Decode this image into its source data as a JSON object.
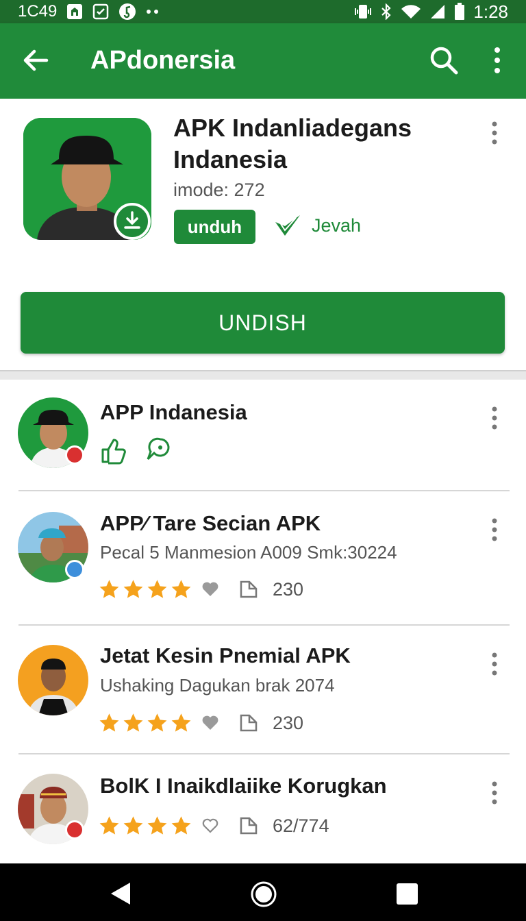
{
  "status_bar": {
    "left_text": "1C49",
    "time": "1:28"
  },
  "app_bar": {
    "title": "APdonersia",
    "back_icon": "arrow-left-icon",
    "search_icon": "search-icon",
    "more_icon": "more-vert-icon"
  },
  "hero": {
    "title": "APK Indanliadegans Indanesia",
    "subtitle": "imode: 272",
    "chip_label": "unduh",
    "verified_label": "Jevah",
    "primary_button": "UNDISH"
  },
  "list": [
    {
      "title": "APP Indanesia",
      "subtitle": "",
      "icons": [
        "thumbs-up-icon",
        "chat-icon"
      ]
    },
    {
      "title": "APP⁄ Tare Secian APK",
      "subtitle": "Pecal 5 Manmesion A009 Smk:30224",
      "rating": 4,
      "count": "230"
    },
    {
      "title": "Jetat Kesin Pnemial APK",
      "subtitle": "Ushaking Dagukan brak 2074",
      "rating": 4,
      "count": "230"
    },
    {
      "title": "BolK I Inaikdlaiike Korugkan",
      "subtitle": "",
      "rating": 4,
      "count": "62/774"
    }
  ],
  "colors": {
    "status_bar": "#1e6b2c",
    "app_bar": "#208b3a",
    "accent": "#1f8a39",
    "star": "#f5a21c"
  }
}
